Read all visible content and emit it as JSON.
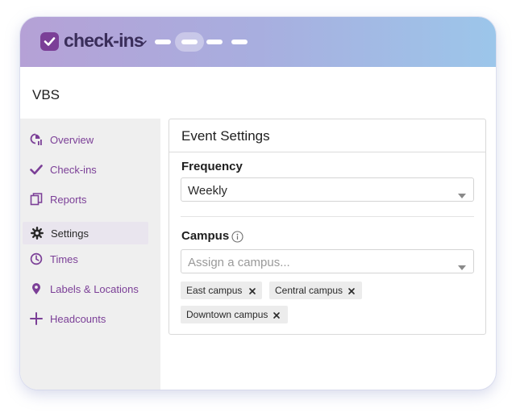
{
  "app": {
    "name": "check-ins",
    "brand_color": "#7b3f97",
    "logo_icon": "checkmark-badge-icon",
    "switcher_icon": "chevron-down-icon",
    "nav_pills": 4
  },
  "page": {
    "title": "VBS"
  },
  "sidebar": {
    "items": [
      {
        "label": "Overview",
        "icon": "overview-chart-icon",
        "active": false
      },
      {
        "label": "Check-ins",
        "icon": "check-icon",
        "active": false
      },
      {
        "label": "Reports",
        "icon": "reports-icon",
        "active": false
      },
      {
        "label": "Settings",
        "icon": "gear-icon",
        "active": true
      },
      {
        "label": "Times",
        "icon": "clock-icon",
        "active": false
      },
      {
        "label": "Labels & Locations",
        "icon": "location-pin-icon",
        "active": false
      },
      {
        "label": "Headcounts",
        "icon": "plus-icon",
        "active": false
      }
    ]
  },
  "event_settings": {
    "title": "Event Settings",
    "frequency": {
      "label": "Frequency",
      "value": "Weekly"
    },
    "campus": {
      "label": "Campus",
      "placeholder": "Assign a campus...",
      "tags": [
        "East campus",
        "Central campus",
        "Downtown campus"
      ]
    }
  }
}
